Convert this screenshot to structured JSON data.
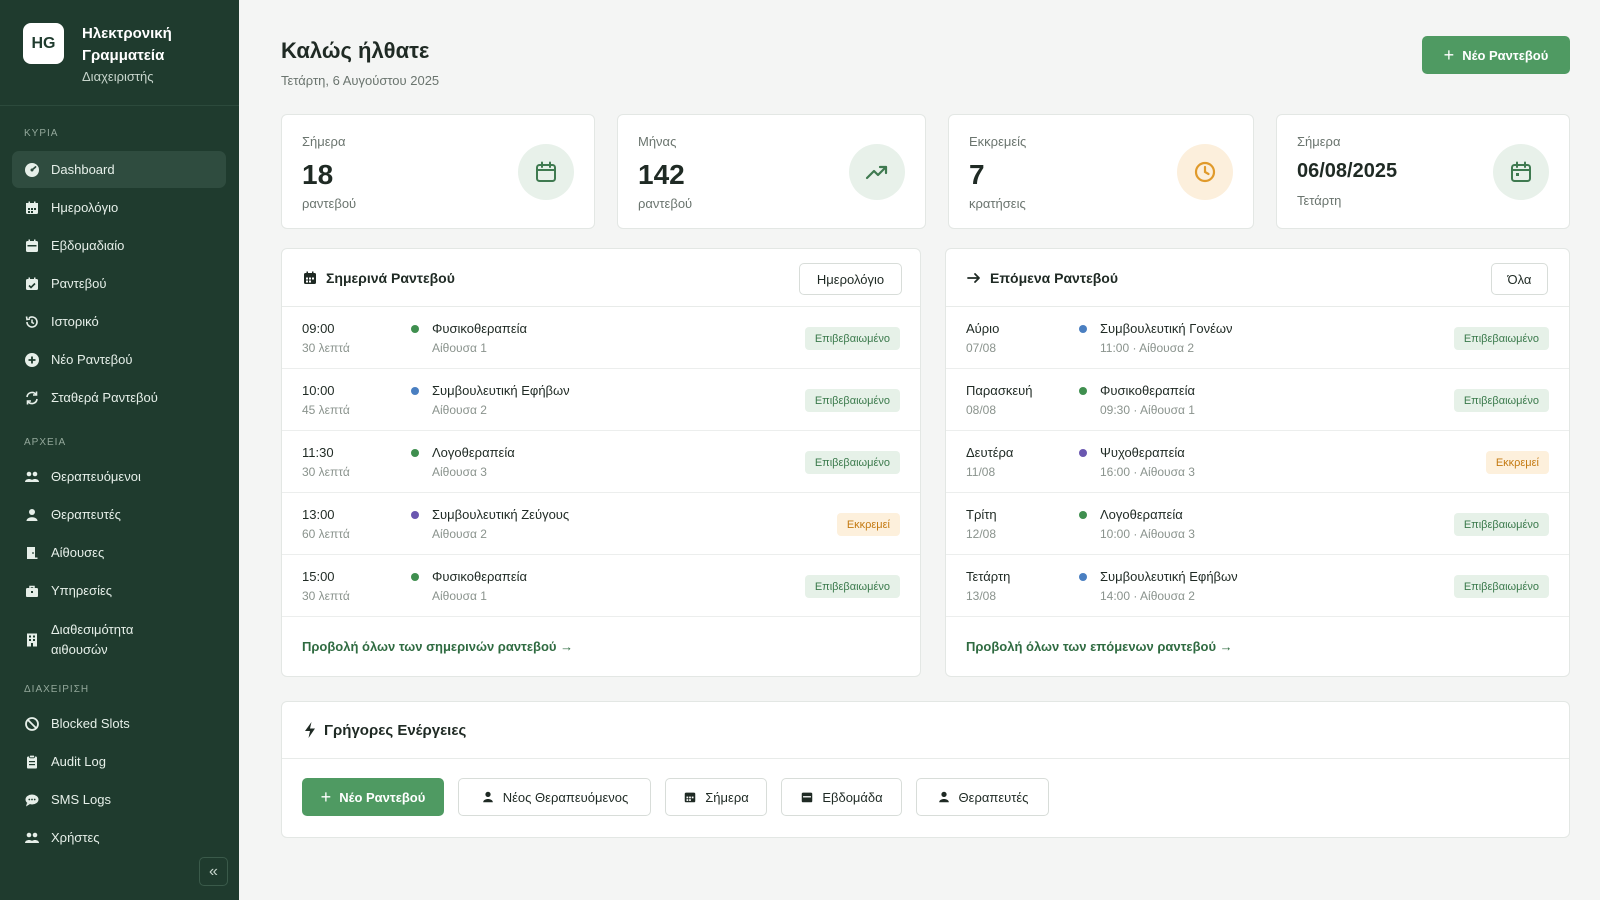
{
  "app": {
    "logo_text": "HG",
    "title": "Ηλεκτρονική Γραμματεία",
    "role": "Διαχειριστής"
  },
  "sidebar": {
    "sections": [
      "ΚΥΡΙΑ",
      "ΑΡΧΕΙΑ",
      "ΔΙΑΧΕΙΡΙΣΗ"
    ],
    "main_items": [
      {
        "label": "Dashboard",
        "icon": "dashboard-icon"
      },
      {
        "label": "Ημερολόγιο",
        "icon": "calendar-icon"
      },
      {
        "label": "Εβδομαδιαίο",
        "icon": "week-icon"
      },
      {
        "label": "Ραντεβού",
        "icon": "appointment-icon"
      },
      {
        "label": "Ιστορικό",
        "icon": "history-icon"
      },
      {
        "label": "Νέο Ραντεβού",
        "icon": "plus-circle-icon"
      },
      {
        "label": "Σταθερά Ραντεβού",
        "icon": "repeat-icon"
      }
    ],
    "archive_items": [
      {
        "label": "Θεραπευόμενοι",
        "icon": "users-icon"
      },
      {
        "label": "Θεραπευτές",
        "icon": "user-icon"
      },
      {
        "label": "Αίθουσες",
        "icon": "door-icon"
      },
      {
        "label": "Υπηρεσίες",
        "icon": "briefcase-icon"
      },
      {
        "label": "Διαθεσιμότητα αιθουσών",
        "icon": "building-icon"
      }
    ],
    "admin_items": [
      {
        "label": "Blocked Slots",
        "icon": "ban-icon"
      },
      {
        "label": "Audit Log",
        "icon": "clipboard-icon"
      },
      {
        "label": "SMS Logs",
        "icon": "message-icon"
      },
      {
        "label": "Χρήστες",
        "icon": "users-icon"
      }
    ],
    "collapse_symbol": "«"
  },
  "header": {
    "welcome": "Καλώς ήλθατε",
    "date": "Τετάρτη, 6 Αυγούστου 2025",
    "new_button": "Νέο Ραντεβού"
  },
  "stats": [
    {
      "label": "Σήμερα",
      "value": "18",
      "sub": "ραντεβού",
      "icon": "calendar-icon"
    },
    {
      "label": "Μήνας",
      "value": "142",
      "sub": "ραντεβού",
      "icon": "trending-up-icon"
    },
    {
      "label": "Εκκρεμείς",
      "value": "7",
      "sub": "κρατήσεις",
      "icon": "clock-icon"
    },
    {
      "label": "Σήμερα",
      "value": "06/08/2025",
      "sub": "Τετάρτη",
      "icon": "calendar-icon"
    }
  ],
  "today_panel": {
    "title": "Σημερινά Ραντεβού",
    "button": "Ημερολόγιο",
    "rows": [
      {
        "time": "09:00",
        "duration": "30 λεπτά",
        "service": "Φυσικοθεραπεία",
        "room": "Αίθουσα 1",
        "status": "Επιβεβαιωμένο",
        "status_type": "ok",
        "dot": "#3f8f4f"
      },
      {
        "time": "10:00",
        "duration": "45 λεπτά",
        "service": "Συμβουλευτική Εφήβων",
        "room": "Αίθουσα 2",
        "status": "Επιβεβαιωμένο",
        "status_type": "ok",
        "dot": "#4a7fc1"
      },
      {
        "time": "11:30",
        "duration": "30 λεπτά",
        "service": "Λογοθεραπεία",
        "room": "Αίθουσα 3",
        "status": "Επιβεβαιωμένο",
        "status_type": "ok",
        "dot": "#3f8f4f"
      },
      {
        "time": "13:00",
        "duration": "60 λεπτά",
        "service": "Συμβουλευτική Ζεύγους",
        "room": "Αίθουσα 2",
        "status": "Εκκρεμεί",
        "status_type": "pend",
        "dot": "#6a57b0"
      },
      {
        "time": "15:00",
        "duration": "30 λεπτά",
        "service": "Φυσικοθεραπεία",
        "room": "Αίθουσα 1",
        "status": "Επιβεβαιωμένο",
        "status_type": "ok",
        "dot": "#3f8f4f"
      }
    ],
    "link": "Προβολή όλων των σημερινών ραντεβού →"
  },
  "next_panel": {
    "title": "Επόμενα Ραντεβού",
    "button": "Όλα",
    "rows": [
      {
        "day": "Αύριο",
        "date": "07/08",
        "service": "Συμβουλευτική Γονέων",
        "detail": "11:00 · Αίθουσα 2",
        "status": "Επιβεβαιωμένο",
        "status_type": "ok",
        "dot": "#4a7fc1"
      },
      {
        "day": "Παρασκευή",
        "date": "08/08",
        "service": "Φυσικοθεραπεία",
        "detail": "09:30 · Αίθουσα 1",
        "status": "Επιβεβαιωμένο",
        "status_type": "ok",
        "dot": "#3f8f4f"
      },
      {
        "day": "Δευτέρα",
        "date": "11/08",
        "service": "Ψυχοθεραπεία",
        "detail": "16:00 · Αίθουσα 3",
        "status": "Εκκρεμεί",
        "status_type": "pend",
        "dot": "#6a57b0"
      },
      {
        "day": "Τρίτη",
        "date": "12/08",
        "service": "Λογοθεραπεία",
        "detail": "10:00 · Αίθουσα 3",
        "status": "Επιβεβαιωμένο",
        "status_type": "ok",
        "dot": "#3f8f4f"
      },
      {
        "day": "Τετάρτη",
        "date": "13/08",
        "service": "Συμβουλευτική Εφήβων",
        "detail": "14:00 · Αίθουσα 2",
        "status": "Επιβεβαιωμένο",
        "status_type": "ok",
        "dot": "#4a7fc1"
      }
    ],
    "link": "Προβολή όλων των επόμενων ραντεβού →"
  },
  "quick_actions": {
    "title": "Γρήγορες Ενέργειες",
    "buttons": [
      {
        "label": "Νέο Ραντεβού",
        "icon": "plus-icon"
      },
      {
        "label": "Νέος Θεραπευόμενος",
        "icon": "user-icon"
      },
      {
        "label": "Σήμερα",
        "icon": "calendar-icon"
      },
      {
        "label": "Εβδομάδα",
        "icon": "calendar-icon"
      },
      {
        "label": "Θεραπευτές",
        "icon": "user-icon"
      }
    ]
  },
  "colors": {
    "sidebar_bg": "#1f3b2e",
    "accent_green": "#4f9a62",
    "status_ok_text": "#3b7a4c",
    "status_pending_text": "#c47a12"
  }
}
